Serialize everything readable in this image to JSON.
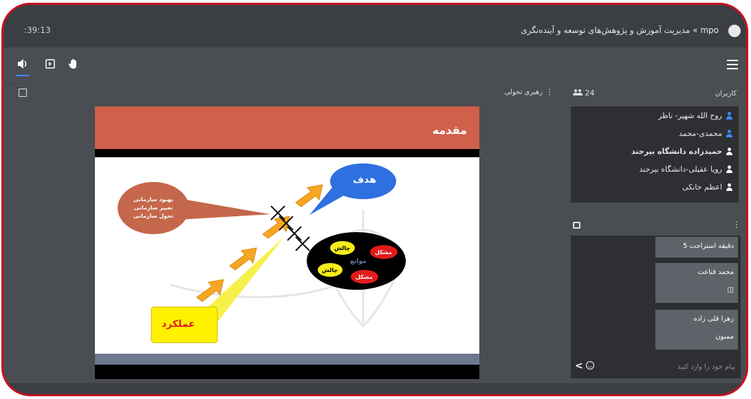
{
  "header": {
    "time": ":39:13",
    "title": "mpo » مدیریت آموزش و پژوهش‌های توسعه و آینده‌نگری"
  },
  "toolbar": {
    "icons": [
      "speaker-icon",
      "presentation-icon",
      "raise-hand-icon",
      "menu-icon"
    ]
  },
  "content": {
    "label": "رهبری تحولی"
  },
  "slide": {
    "title": "مقدمه",
    "goal": "هدف",
    "performance": "عملکرد",
    "org_bubble": [
      "بهبود سازمانی",
      "تغییر سازمانی",
      "تحول سازمانی"
    ],
    "obstacles": "موانع",
    "challenge": "چالش",
    "problem": "مشکل",
    "colors": {
      "header": "#d0604a",
      "goal": "#2f6fe0",
      "performance": "#fff200",
      "bubble": "#c5674a"
    }
  },
  "users": {
    "label": "کاربران",
    "count": "24",
    "list": [
      "روح الله شهپر- ناظر",
      "محمدی-محمد",
      "حمیدزاده دانشگاه بیرجند",
      "رویا عقیلی-دانشگاه بیرجند",
      "اعظم خانکی"
    ]
  },
  "chat": {
    "messages": [
      {
        "text": "دقیقه استراحت 5"
      },
      {
        "author": "محمد قناعت",
        "text": "◫"
      },
      {
        "author": "زهرا قلی زاده",
        "text": "ممنون"
      }
    ],
    "placeholder": "پیام خود را وارد کنید"
  }
}
